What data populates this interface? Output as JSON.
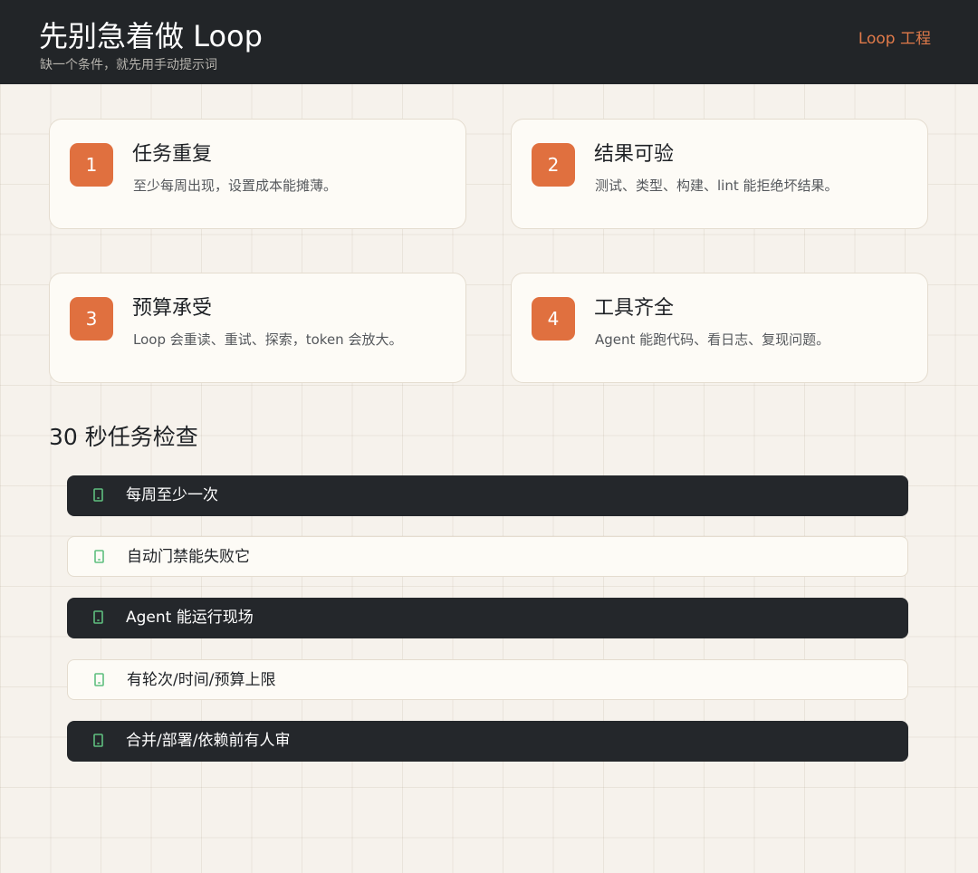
{
  "header": {
    "title": "先别急着做 Loop",
    "subtitle": "缺一个条件，就先用手动提示词",
    "link": "Loop 工程"
  },
  "cards": [
    {
      "number": "1",
      "title": "任务重复",
      "desc": "至少每周出现，设置成本能摊薄。"
    },
    {
      "number": "2",
      "title": "结果可验",
      "desc": "测试、类型、构建、lint 能拒绝坏结果。"
    },
    {
      "number": "3",
      "title": "预算承受",
      "desc": "Loop 会重读、重试、探索，token 会放大。"
    },
    {
      "number": "4",
      "title": "工具齐全",
      "desc": "Agent 能跑代码、看日志、复现问题。"
    }
  ],
  "section": {
    "title": "30 秒任务检查"
  },
  "checklist": [
    {
      "label": "每周至少一次",
      "theme": "dark"
    },
    {
      "label": "自动门禁能失败它",
      "theme": "light"
    },
    {
      "label": "Agent 能运行现场",
      "theme": "dark"
    },
    {
      "label": "有轮次/时间/预算上限",
      "theme": "light"
    },
    {
      "label": "合并/部署/依赖前有人审",
      "theme": "dark"
    }
  ],
  "colors": {
    "accent": "#e0703f",
    "header_bg": "#222528",
    "dark_row": "#24272b",
    "check_icon": "#5fbf7f",
    "page_bg": "#f6f2ec"
  },
  "icons": {
    "checkbox": "phone-checkbox-icon"
  }
}
